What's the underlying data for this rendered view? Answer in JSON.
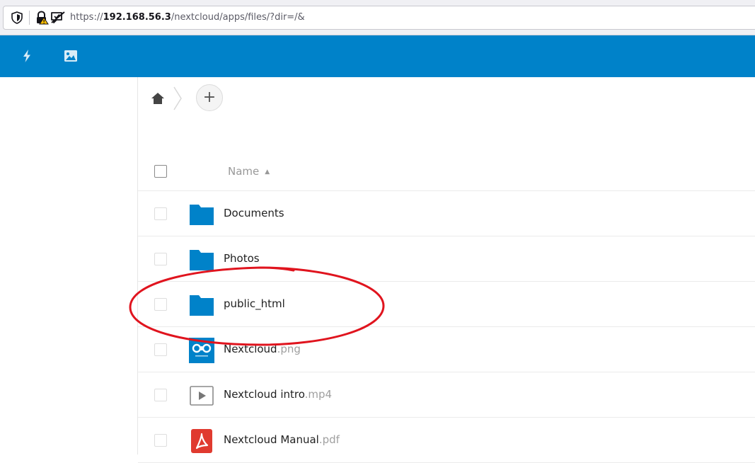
{
  "browser": {
    "url_prefix": "https://",
    "url_host": "192.168.56.3",
    "url_path": "/nextcloud/apps/files/?dir=/&",
    "icons": [
      "shield-icon",
      "lock-warning-icon",
      "permissions-icon"
    ]
  },
  "header": {
    "icons": [
      "activity-icon",
      "gallery-icon"
    ],
    "color": "#0082c9"
  },
  "breadcrumb": {
    "home_icon": "home-icon",
    "new_label": "+"
  },
  "file_list": {
    "column_name": "Name",
    "sort_indicator": "▲",
    "files": [
      {
        "name": "Documents",
        "ext": "",
        "icon": "folder-icon"
      },
      {
        "name": "Photos",
        "ext": "",
        "icon": "folder-icon"
      },
      {
        "name": "public_html",
        "ext": "",
        "icon": "folder-icon"
      },
      {
        "name": "Nextcloud",
        "ext": ".png",
        "icon": "image-thumbnail-icon"
      },
      {
        "name": "Nextcloud intro",
        "ext": ".mp4",
        "icon": "video-icon"
      },
      {
        "name": "Nextcloud Manual",
        "ext": ".pdf",
        "icon": "pdf-icon"
      }
    ]
  },
  "annotation": {
    "color": "#e0141e",
    "shape": "ellipse"
  }
}
